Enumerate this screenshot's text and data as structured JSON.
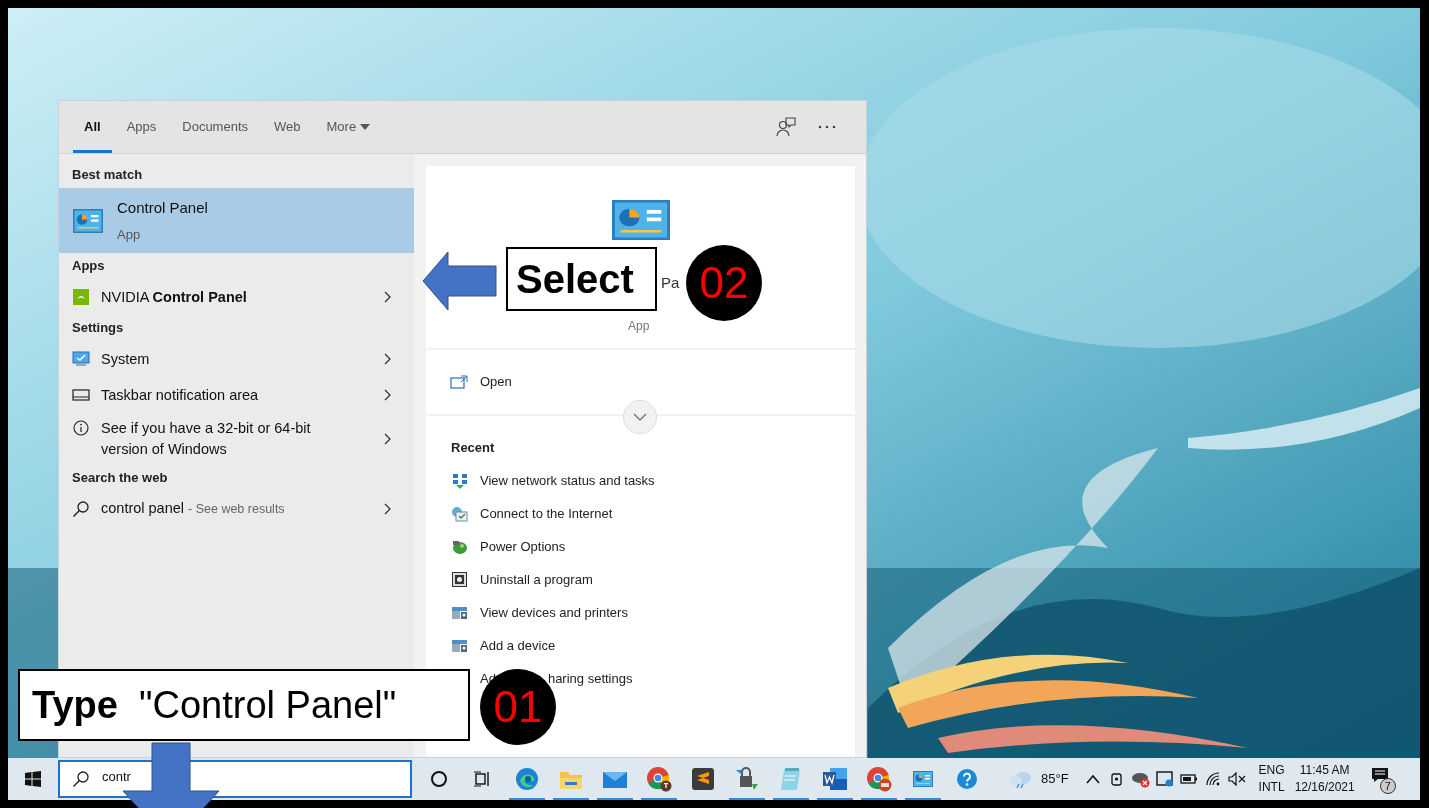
{
  "start_menu": {
    "tabs": [
      {
        "label": "All",
        "selected": true,
        "kind": "plain"
      },
      {
        "label": "Apps",
        "selected": false,
        "kind": "plain"
      },
      {
        "label": "Documents",
        "selected": false,
        "kind": "plain"
      },
      {
        "label": "Web",
        "selected": false,
        "kind": "plain"
      },
      {
        "label": "More",
        "selected": false,
        "kind": "dropdown"
      }
    ],
    "sections": [
      {
        "heading": "Best match",
        "items": [
          {
            "kind": "best",
            "title": "Control Panel",
            "subtitle": "App",
            "selected": true
          }
        ]
      },
      {
        "heading": "Apps",
        "items": [
          {
            "kind": "row",
            "title": "NVIDIA **Control Panel**",
            "selected": false
          }
        ]
      },
      {
        "heading": "Settings",
        "items": [
          {
            "kind": "row",
            "title": "System",
            "selected": false
          },
          {
            "kind": "row",
            "title": "Taskbar notification area",
            "selected": false
          },
          {
            "kind": "tall",
            "title": "See if you have a 32-bit or 64-bit version of Windows",
            "selected": false
          }
        ]
      },
      {
        "heading": "Search the web",
        "items": [
          {
            "kind": "web",
            "title": "control panel",
            "hint": "- See web results",
            "selected": false
          }
        ]
      }
    ],
    "preview": {
      "title_fragment": "Pa",
      "subtitle": "App",
      "action": "Open",
      "recent_heading": "Recent",
      "recent": [
        {
          "kind": "full",
          "label": "View network status and tasks"
        },
        {
          "kind": "full",
          "label": "Connect to the Internet"
        },
        {
          "kind": "full",
          "label": "Power Options"
        },
        {
          "kind": "full",
          "label": "Uninstall a program"
        },
        {
          "kind": "full",
          "label": "View devices and printers"
        },
        {
          "kind": "full",
          "label": "Add a device"
        },
        {
          "kind": "split",
          "label": "Ad",
          "tail": "haring settings"
        }
      ]
    }
  },
  "taskbar": {
    "search": {
      "value": "contr"
    },
    "apps": [
      {
        "running": false
      },
      {
        "running": false
      },
      {
        "running": true
      },
      {
        "running": true
      },
      {
        "running": true
      },
      {
        "running": true
      },
      {
        "running": false
      },
      {
        "running": true
      },
      {
        "running": true
      },
      {
        "running": true
      },
      {
        "running": true
      },
      {
        "running": true
      },
      {
        "running": false
      }
    ],
    "weather": "85°F",
    "language": [
      "ENG",
      "INTL"
    ],
    "time": "11:45 AM",
    "date": "12/16/2021",
    "notifications": "7"
  },
  "annotations": [
    {
      "kind": "left",
      "text": "Select",
      "number": "02"
    },
    {
      "kind": "down",
      "text": "**Type**  \"Control Panel\"",
      "number": "01"
    }
  ]
}
